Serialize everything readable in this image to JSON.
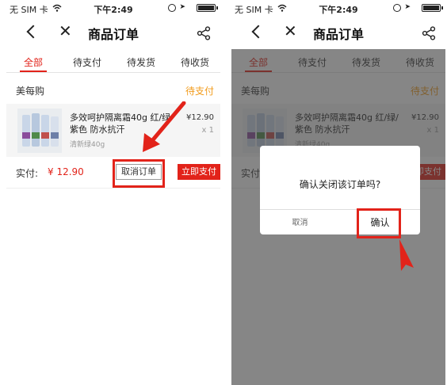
{
  "status_bar": {
    "carrier": "无 SIM 卡",
    "time": "下午2:49"
  },
  "header": {
    "title": "商品订单"
  },
  "tabs": [
    {
      "label": "全部",
      "active": true
    },
    {
      "label": "待支付",
      "active": false
    },
    {
      "label": "待发货",
      "active": false
    },
    {
      "label": "待收货",
      "active": false
    }
  ],
  "order": {
    "shop_name": "美每购",
    "status": "待支付",
    "product_name": "多效呵护隔离霜40g 红/绿/紫色 防水抗汗",
    "product_spec": "清新绿40g",
    "price": "¥12.90",
    "quantity": "x 1",
    "paid_label": "实付:",
    "paid_amount": "¥ 12.90",
    "cancel_button": "取消订单",
    "pay_button": "立即支付"
  },
  "dialog": {
    "message": "确认关闭该订单吗?",
    "cancel_label": "取消",
    "confirm_label": "确认"
  },
  "colors": {
    "accent": "#e2231a",
    "status_orange": "#f29b1b",
    "product_bg": "#f5f5f5"
  }
}
